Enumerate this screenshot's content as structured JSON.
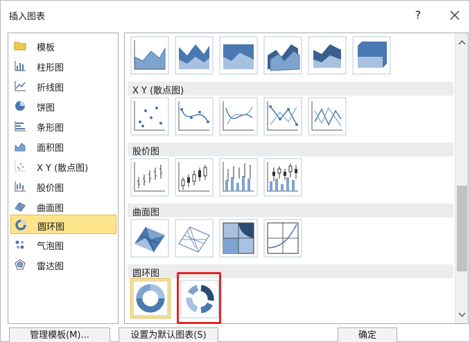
{
  "dialog": {
    "title": "插入图表",
    "help_label": "?"
  },
  "sidebar": {
    "items": [
      {
        "label": "模板",
        "icon": "folder-icon"
      },
      {
        "label": "柱形图",
        "icon": "column-chart-icon"
      },
      {
        "label": "折线图",
        "icon": "line-chart-icon"
      },
      {
        "label": "饼图",
        "icon": "pie-chart-icon"
      },
      {
        "label": "条形图",
        "icon": "bar-chart-icon"
      },
      {
        "label": "面积图",
        "icon": "area-chart-icon"
      },
      {
        "label": "X Y (散点图)",
        "icon": "scatter-chart-icon"
      },
      {
        "label": "股价图",
        "icon": "stock-chart-icon"
      },
      {
        "label": "曲面图",
        "icon": "surface-chart-icon"
      },
      {
        "label": "圆环图",
        "icon": "doughnut-chart-icon",
        "selected": true
      },
      {
        "label": "气泡图",
        "icon": "bubble-chart-icon"
      },
      {
        "label": "雷达图",
        "icon": "radar-chart-icon"
      }
    ]
  },
  "gallery": {
    "sections": [
      {
        "label": "X Y (散点图)"
      },
      {
        "label": "股价图"
      },
      {
        "label": "曲面图"
      },
      {
        "label": "圆环图"
      }
    ]
  },
  "footer": {
    "manage_templates": "管理模板(M)...",
    "set_default": "设置为默认图表(S)",
    "ok": "确定"
  },
  "colors": {
    "selection_fill": "#fde48a",
    "highlight_border": "#e02424",
    "chart_blue": "#4a78b0"
  }
}
